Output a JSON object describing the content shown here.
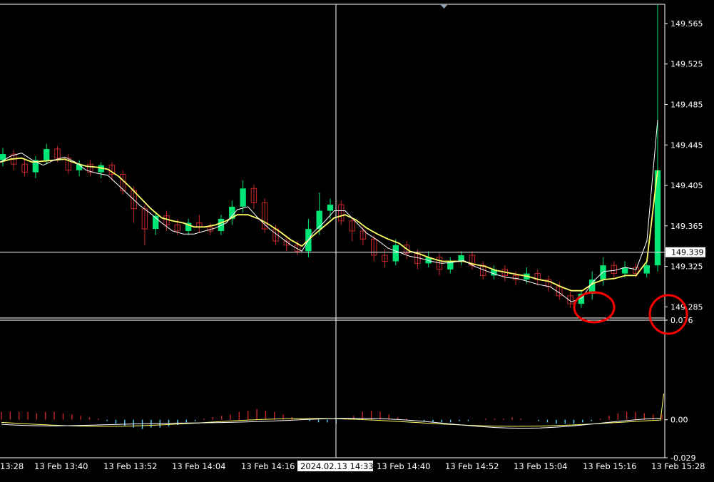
{
  "chart_data": [
    {
      "type": "candlestick",
      "price_ticks": [
        "149.565",
        "149.525",
        "149.485",
        "149.445",
        "149.405",
        "149.365",
        "149.325",
        "149.285"
      ],
      "ylim": [
        149.274,
        149.584
      ],
      "crosshair": {
        "price_label": "149.339",
        "price": 149.339,
        "time_label": "2024.02.13 14:33"
      },
      "time_labels": [
        "13:28",
        "13 Feb 13:40",
        "13 Feb 13:52",
        "13 Feb 14:04",
        "13 Feb 14:16",
        "13 Feb 14:40",
        "13 Feb 14:52",
        "13 Feb 15:04",
        "13 Feb 15:16",
        "13 Feb 15:28"
      ],
      "series": [
        {
          "name": "",
          "color": "#ffff66",
          "values": [
            149.428,
            149.431,
            149.432,
            149.428,
            149.429,
            149.43,
            149.431,
            149.427,
            149.424,
            149.423,
            149.421,
            149.414,
            149.404,
            149.393,
            149.382,
            149.373,
            149.37,
            149.368,
            149.364,
            149.364,
            149.366,
            149.37,
            149.376,
            149.376,
            149.372,
            149.366,
            149.359,
            149.351,
            149.345,
            149.355,
            149.364,
            149.373,
            149.376,
            149.371,
            149.363,
            149.357,
            149.352,
            149.348,
            149.34,
            149.337,
            149.333,
            149.33,
            149.33,
            149.33,
            149.327,
            149.325,
            149.321,
            149.319,
            149.317,
            149.315,
            149.312,
            149.31,
            149.305,
            149.301,
            149.301,
            149.308,
            149.312,
            149.313,
            149.316,
            149.316,
            149.33,
            149.42
          ]
        },
        {
          "name": "",
          "color": "#ffffff",
          "values": [
            149.428,
            149.434,
            149.437,
            149.43,
            149.425,
            149.43,
            149.433,
            149.428,
            149.42,
            149.417,
            149.415,
            149.405,
            149.395,
            149.385,
            149.377,
            149.368,
            149.36,
            149.357,
            149.357,
            149.36,
            149.363,
            149.368,
            149.381,
            149.384,
            149.372,
            149.362,
            149.354,
            149.346,
            149.34,
            149.358,
            149.368,
            149.38,
            149.38,
            149.369,
            149.358,
            149.351,
            149.343,
            149.339,
            149.335,
            149.333,
            149.33,
            149.328,
            149.329,
            149.331,
            149.325,
            149.321,
            149.317,
            149.314,
            149.313,
            149.31,
            149.307,
            149.305,
            149.298,
            149.29,
            149.294,
            149.31,
            149.32,
            149.321,
            149.324,
            149.322,
            149.35,
            149.47
          ]
        }
      ],
      "candles": [
        [
          149.43,
          149.436,
          149.442,
          149.424
        ],
        [
          149.436,
          149.426,
          149.44,
          149.42
        ],
        [
          149.426,
          149.418,
          149.432,
          149.414
        ],
        [
          149.418,
          149.43,
          149.434,
          149.412
        ],
        [
          149.43,
          149.441,
          149.446,
          149.426
        ],
        [
          149.441,
          149.432,
          149.444,
          149.428
        ],
        [
          149.432,
          149.42,
          149.436,
          149.416
        ],
        [
          149.42,
          149.426,
          149.43,
          149.414
        ],
        [
          149.426,
          149.418,
          149.43,
          149.414
        ],
        [
          149.418,
          149.425,
          149.428,
          149.412
        ],
        [
          149.425,
          149.416,
          149.428,
          149.41
        ],
        [
          149.416,
          149.4,
          149.42,
          149.396
        ],
        [
          149.4,
          149.382,
          149.404,
          149.368
        ],
        [
          149.382,
          149.362,
          149.386,
          149.346
        ],
        [
          149.362,
          149.375,
          149.378,
          149.356
        ],
        [
          149.375,
          149.366,
          149.38,
          149.36
        ],
        [
          149.366,
          149.36,
          149.372,
          149.356
        ],
        [
          149.36,
          149.368,
          149.372,
          149.356
        ],
        [
          149.368,
          149.364,
          149.376,
          149.358
        ],
        [
          149.364,
          149.36,
          149.368,
          149.356
        ],
        [
          149.36,
          149.372,
          149.376,
          149.356
        ],
        [
          149.372,
          149.384,
          149.39,
          149.366
        ],
        [
          149.384,
          149.402,
          149.41,
          149.378
        ],
        [
          149.402,
          149.388,
          149.406,
          149.382
        ],
        [
          149.388,
          149.362,
          149.392,
          149.358
        ],
        [
          149.362,
          149.35,
          149.366,
          149.346
        ],
        [
          149.35,
          149.346,
          149.354,
          149.34
        ],
        [
          149.346,
          149.34,
          149.35,
          149.336
        ],
        [
          149.34,
          149.362,
          149.372,
          149.334
        ],
        [
          149.362,
          149.38,
          149.398,
          149.356
        ],
        [
          149.38,
          149.386,
          149.392,
          149.372
        ],
        [
          149.386,
          149.37,
          149.39,
          149.366
        ],
        [
          149.37,
          149.36,
          149.374,
          149.35
        ],
        [
          149.36,
          149.352,
          149.364,
          149.346
        ],
        [
          149.352,
          149.336,
          149.356,
          149.33
        ],
        [
          149.336,
          149.33,
          149.342,
          149.324
        ],
        [
          149.33,
          149.346,
          149.352,
          149.326
        ],
        [
          149.346,
          149.338,
          149.35,
          149.332
        ],
        [
          149.338,
          149.328,
          149.342,
          149.322
        ],
        [
          149.328,
          149.334,
          149.34,
          149.324
        ],
        [
          149.334,
          149.322,
          149.338,
          149.316
        ],
        [
          149.322,
          149.33,
          149.334,
          149.318
        ],
        [
          149.33,
          149.336,
          149.34,
          149.326
        ],
        [
          149.336,
          149.326,
          149.34,
          149.322
        ],
        [
          149.326,
          149.316,
          149.33,
          149.312
        ],
        [
          149.316,
          149.322,
          149.326,
          149.312
        ],
        [
          149.322,
          149.316,
          149.326,
          149.31
        ],
        [
          149.316,
          149.312,
          149.32,
          149.306
        ],
        [
          149.312,
          149.318,
          149.324,
          149.308
        ],
        [
          149.318,
          149.312,
          149.322,
          149.306
        ],
        [
          149.312,
          149.305,
          149.316,
          149.3
        ],
        [
          149.305,
          149.296,
          149.31,
          149.292
        ],
        [
          149.296,
          149.288,
          149.3,
          149.284
        ],
        [
          149.288,
          149.298,
          149.302,
          149.284
        ],
        [
          149.298,
          149.312,
          149.32,
          149.292
        ],
        [
          149.312,
          149.326,
          149.334,
          149.306
        ],
        [
          149.326,
          149.318,
          149.33,
          149.312
        ],
        [
          149.318,
          149.324,
          149.33,
          149.314
        ],
        [
          149.324,
          149.318,
          149.328,
          149.314
        ],
        [
          149.318,
          149.326,
          149.33,
          149.314
        ],
        [
          149.326,
          149.42,
          149.584,
          149.32
        ]
      ],
      "histogram": [
        0.006,
        0.006,
        0.006,
        0.006,
        0.005,
        0.006,
        0.006,
        0.005,
        0.004,
        0.003,
        0.002,
        0.001,
        -0.001,
        -0.003,
        -0.005,
        -0.006,
        -0.007,
        -0.006,
        -0.006,
        -0.005,
        -0.004,
        -0.002,
        -0.001,
        0.001,
        0.002,
        0.003,
        0.004,
        0.006,
        0.007,
        0.008,
        0.007,
        0.006,
        0.004,
        0.002,
        0.001,
        -0.001,
        -0.002,
        -0.002,
        -0.003,
        0.001,
        0.003,
        0.006,
        0.007,
        0.006,
        0.004,
        0.002,
        0.001,
        0.0,
        -0.001,
        -0.002,
        -0.002,
        -0.002,
        -0.001,
        -0.001,
        0.0,
        0.001,
        0.001,
        0.001,
        0.002,
        0.001,
        0.0,
        -0.001,
        -0.002,
        -0.003,
        -0.003,
        -0.003,
        -0.002,
        -0.001,
        0.001,
        0.003,
        0.005,
        0.006,
        0.006,
        0.005,
        0.004,
        0.004
      ],
      "ind_ticks": [
        "0.076",
        "0.00",
        "-0.029"
      ],
      "ind_ylim": [
        -0.029,
        0.076
      ]
    }
  ]
}
